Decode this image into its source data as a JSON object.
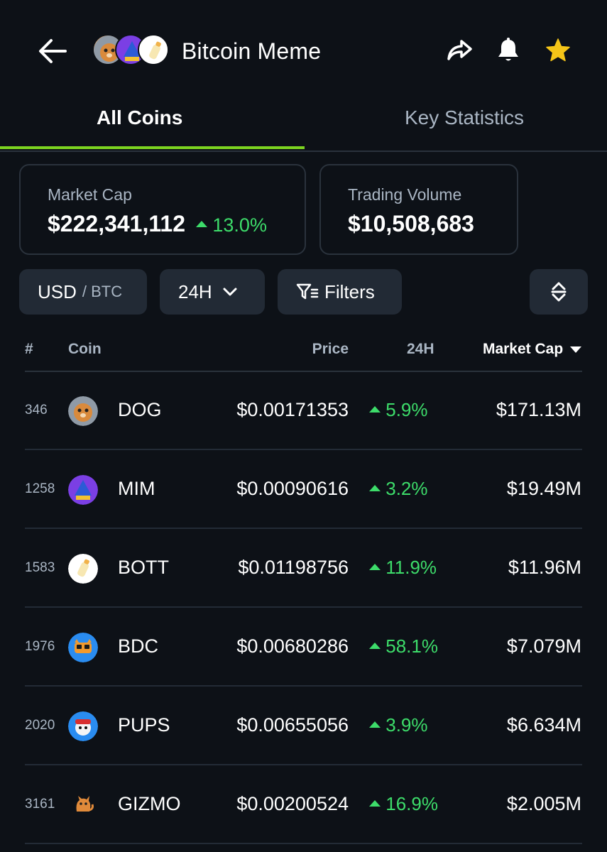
{
  "header": {
    "title": "Bitcoin Meme",
    "icons": [
      "back-arrow-icon",
      "share-icon",
      "bell-icon",
      "star-icon"
    ],
    "star_color": "#f5c518"
  },
  "tabs": [
    {
      "label": "All Coins",
      "active": true
    },
    {
      "label": "Key Statistics",
      "active": false
    }
  ],
  "stats": {
    "market_cap": {
      "label": "Market Cap",
      "value": "$222,341,112",
      "change": "13.0%"
    },
    "trading_volume": {
      "label": "Trading Volume",
      "value": "$10,508,683"
    }
  },
  "controls": {
    "currency_main": "USD",
    "currency_alt": "/ BTC",
    "timeframe": "24H",
    "filters_label": "Filters"
  },
  "table": {
    "headers": {
      "rank": "#",
      "coin": "Coin",
      "price": "Price",
      "change": "24H",
      "market_cap": "Market Cap"
    },
    "rows": [
      {
        "rank": "346",
        "symbol": "DOG",
        "price": "$0.00171353",
        "change": "5.9%",
        "market_cap": "$171.13M"
      },
      {
        "rank": "1258",
        "symbol": "MIM",
        "price": "$0.00090616",
        "change": "3.2%",
        "market_cap": "$19.49M"
      },
      {
        "rank": "1583",
        "symbol": "BOTT",
        "price": "$0.01198756",
        "change": "11.9%",
        "market_cap": "$11.96M"
      },
      {
        "rank": "1976",
        "symbol": "BDC",
        "price": "$0.00680286",
        "change": "58.1%",
        "market_cap": "$7.079M"
      },
      {
        "rank": "2020",
        "symbol": "PUPS",
        "price": "$0.00655056",
        "change": "3.9%",
        "market_cap": "$6.634M"
      },
      {
        "rank": "3161",
        "symbol": "GIZMO",
        "price": "$0.00200524",
        "change": "16.9%",
        "market_cap": "$2.005M"
      }
    ]
  },
  "colors": {
    "background": "#0d1117",
    "accent_green": "#7cd420",
    "positive": "#3ddc6a",
    "muted_text": "#aab6c4",
    "control_bg": "#222a35"
  }
}
